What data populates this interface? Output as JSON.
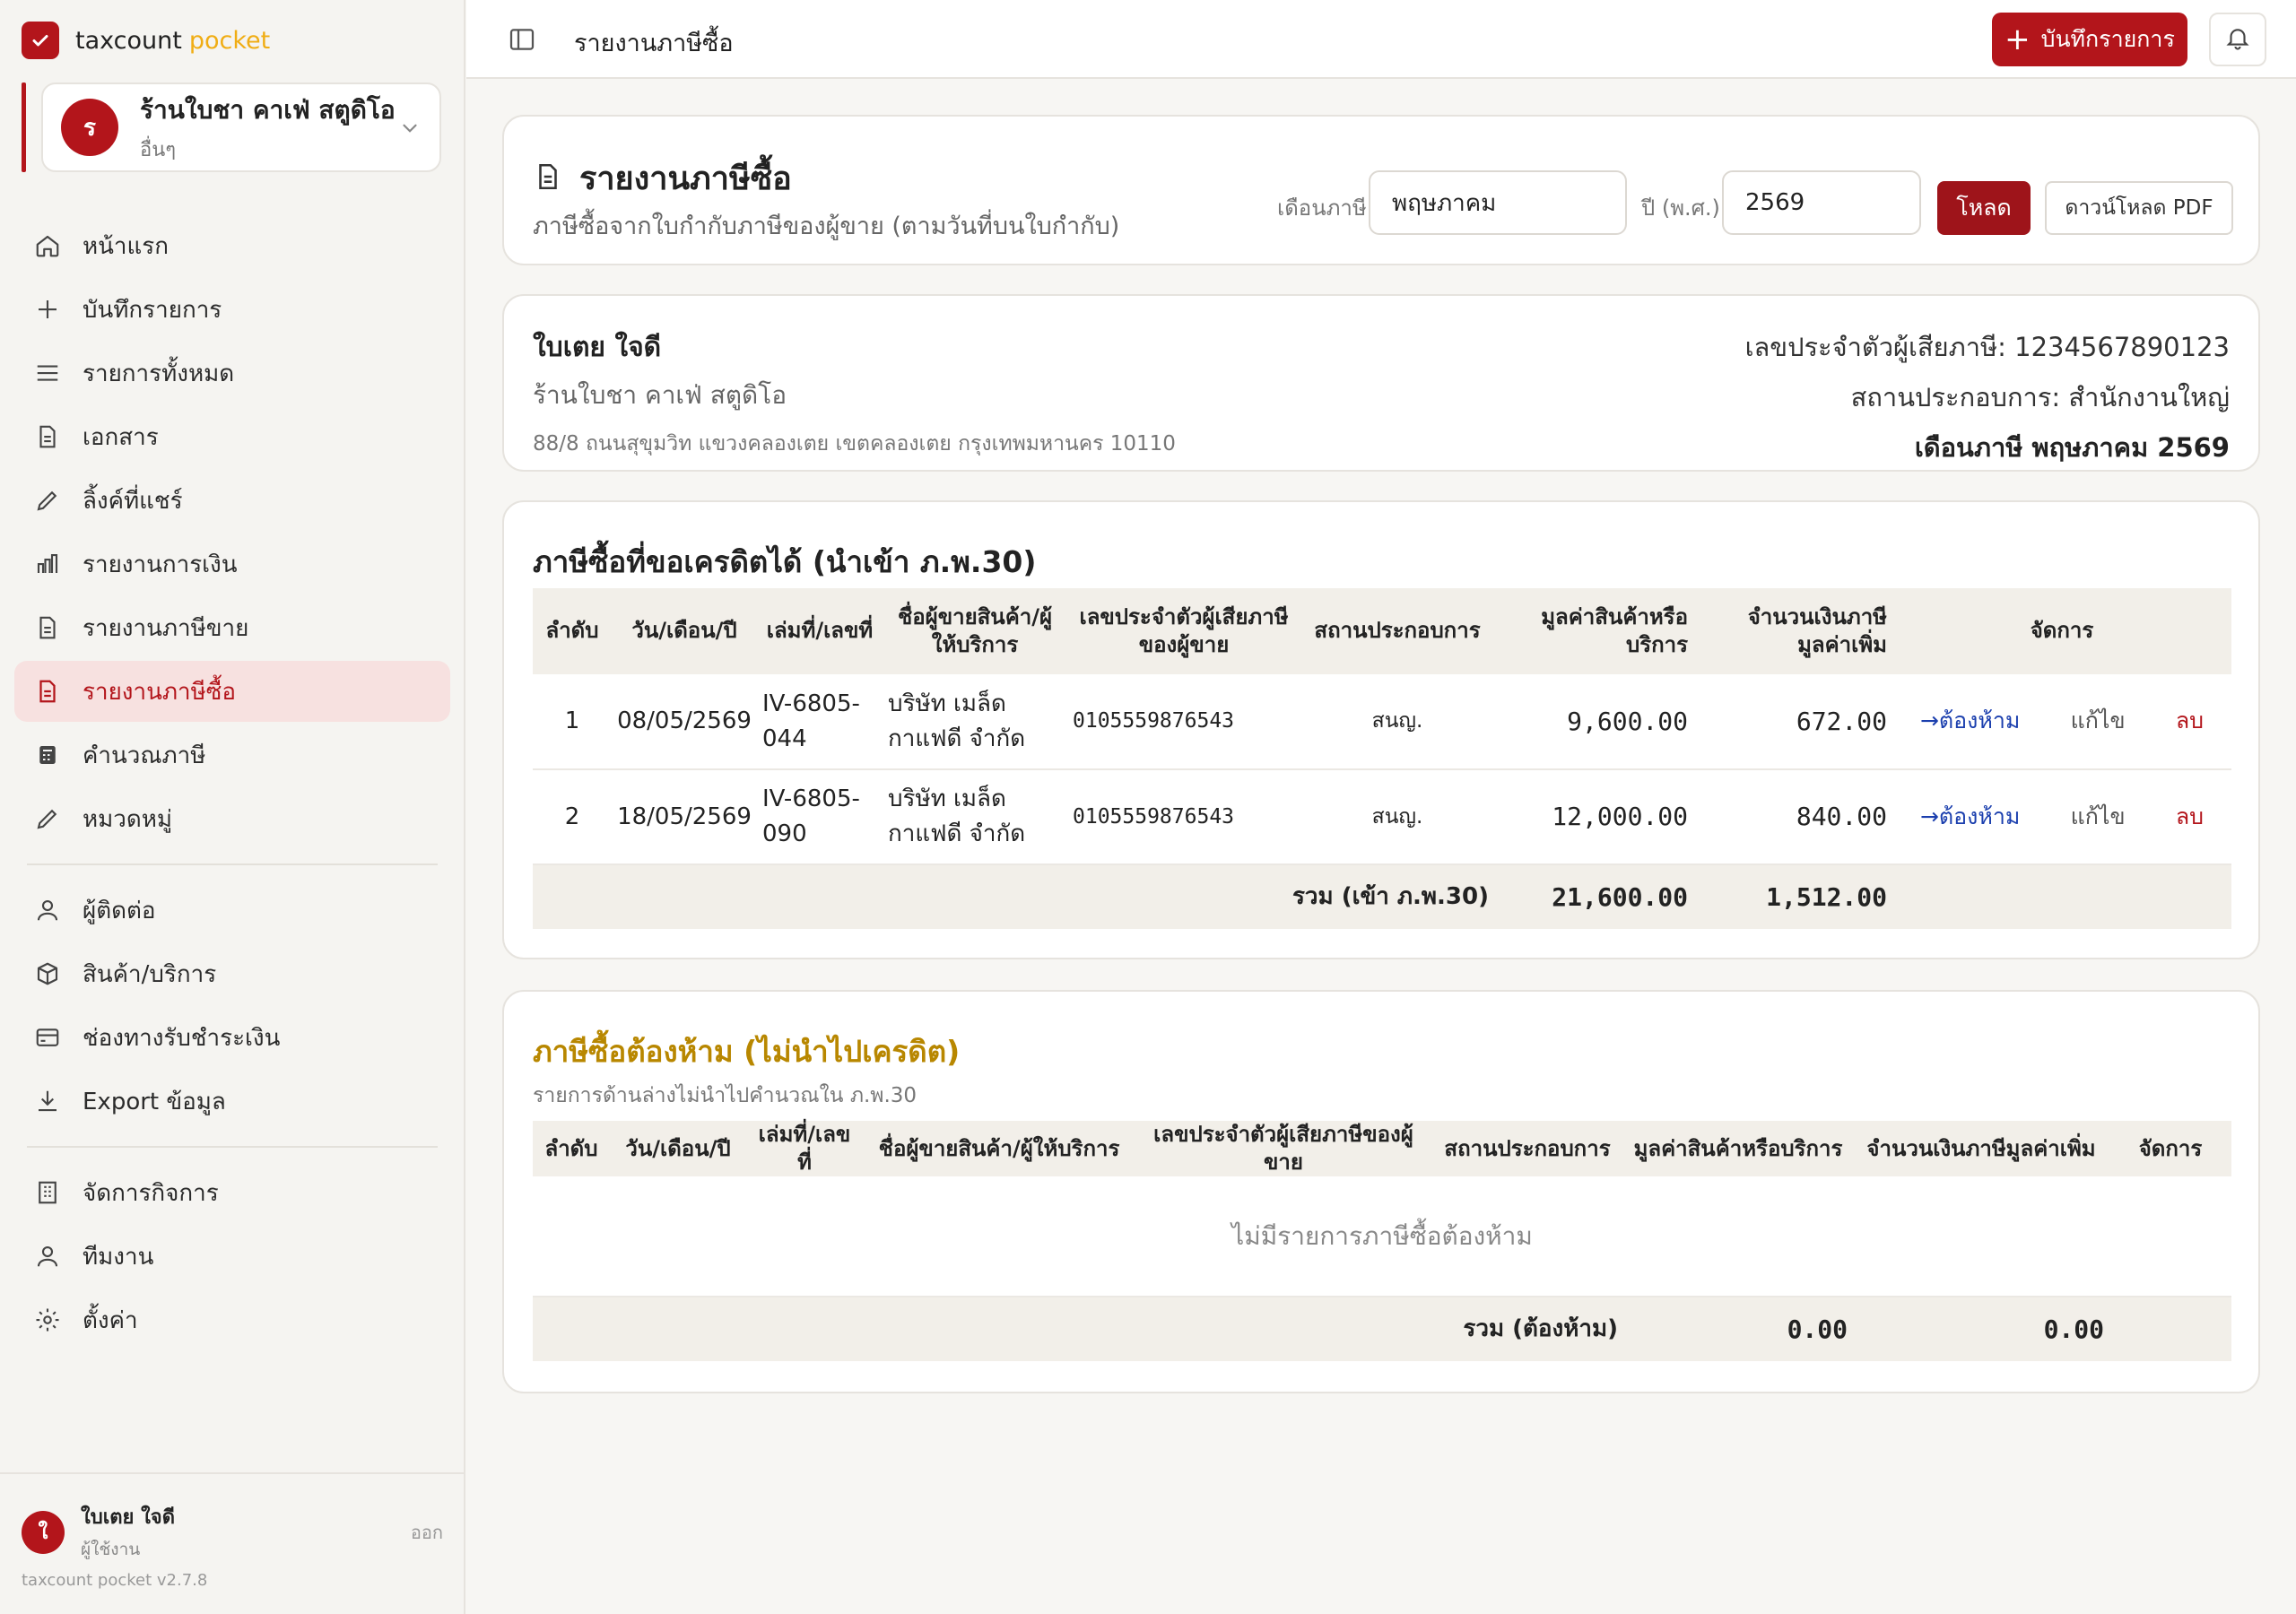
{
  "sidebar": {
    "brand": {
      "name": "taxcount",
      "accent": "pocket"
    },
    "business": {
      "avatar": "ร",
      "name": "ร้านใบชา คาเฟ่ สตูดิโอ",
      "type": "อื่นๆ"
    },
    "nav": [
      {
        "label": "หน้าแรก",
        "icon": "home-icon"
      },
      {
        "label": "บันทึกรายการ",
        "icon": "plus-icon"
      },
      {
        "label": "รายการทั้งหมด",
        "icon": "list-icon"
      },
      {
        "label": "เอกสาร",
        "icon": "document-icon"
      },
      {
        "label": "ลิ้งค์ที่แชร์",
        "icon": "pencil-icon"
      },
      {
        "label": "รายงานการเงิน",
        "icon": "bar-chart-icon"
      },
      {
        "label": "รายงานภาษีขาย",
        "icon": "document-icon"
      },
      {
        "label": "รายงานภาษีซื้อ",
        "icon": "document-icon"
      },
      {
        "label": "คำนวณภาษี",
        "icon": "calculator-icon"
      },
      {
        "label": "หมวดหมู่",
        "icon": "pencil-icon"
      }
    ],
    "nav2": [
      {
        "label": "ผู้ติดต่อ",
        "icon": "user-icon"
      },
      {
        "label": "สินค้า/บริการ",
        "icon": "box-icon"
      },
      {
        "label": "ช่องทางรับชำระเงิน",
        "icon": "credit-card-icon"
      },
      {
        "label": "Export ข้อมูล",
        "icon": "download-icon"
      }
    ],
    "nav3": [
      {
        "label": "จัดการกิจการ",
        "icon": "building-icon"
      },
      {
        "label": "ทีมงาน",
        "icon": "user-icon"
      },
      {
        "label": "ตั้งค่า",
        "icon": "gear-icon"
      }
    ],
    "user": {
      "avatar": "ใ",
      "name": "ใบเตย ใจดี",
      "role": "ผู้ใช้งาน",
      "logout": "ออก"
    },
    "version": "taxcount pocket v2.7.8"
  },
  "topbar": {
    "title": "รายงานภาษีซื้อ",
    "record_label": "บันทึกรายการ"
  },
  "report": {
    "title": "รายงานภาษีซื้อ",
    "subtitle": "ภาษีซื้อจากใบกำกับภาษีของผู้ขาย (ตามวันที่บนใบกำกับ)",
    "month_label": "เดือนภาษี",
    "month_value": "พฤษภาคม",
    "year_label": "ปี (พ.ศ.)",
    "year_value": "2569",
    "load_label": "โหลด",
    "pdf_label": "ดาวน์โหลด PDF"
  },
  "info": {
    "name": "ใบเตย ใจดี",
    "shop": "ร้านใบชา คาเฟ่ สตูดิโอ",
    "address": "88/8 ถนนสุขุมวิท แขวงคลองเตย เขตคลองเตย กรุงเทพมหานคร 10110",
    "tax_id": "เลขประจำตัวผู้เสียภาษี: 1234567890123",
    "branch": "สถานประกอบการ: สำนักงานใหญ่",
    "month": "เดือนภาษี พฤษภาคม 2569"
  },
  "credit": {
    "title": "ภาษีซื้อที่ขอเครดิตได้ (นำเข้า ภ.พ.30)",
    "headers": [
      "ลำดับ",
      "วัน/เดือน/ปี",
      "เล่มที่/เลขที่",
      "ชื่อผู้ขายสินค้า/ผู้ให้บริการ",
      "เลขประจำตัวผู้เสียภาษีของผู้ขาย",
      "สถานประกอบการ",
      "มูลค่าสินค้าหรือบริการ",
      "จำนวนเงินภาษีมูลค่าเพิ่ม",
      "จัดการ"
    ],
    "rows": [
      {
        "no": "1",
        "date": "08/05/2569",
        "doc": "IV-6805-044",
        "vendor": "บริษัท เมล็ดกาแฟดี จำกัด",
        "tax_id": "0105559876543",
        "branch": "สนญ.",
        "amount": "9,600.00",
        "vat": "672.00",
        "action_forbid": "→ต้องห้าม",
        "action_edit": "แก้ไข",
        "action_delete": "ลบ"
      },
      {
        "no": "2",
        "date": "18/05/2569",
        "doc": "IV-6805-090",
        "vendor": "บริษัท เมล็ดกาแฟดี จำกัด",
        "tax_id": "0105559876543",
        "branch": "สนญ.",
        "amount": "12,000.00",
        "vat": "840.00",
        "action_forbid": "→ต้องห้าม",
        "action_edit": "แก้ไข",
        "action_delete": "ลบ"
      }
    ],
    "total_label": "รวม (เข้า ภ.พ.30)",
    "total_amount": "21,600.00",
    "total_vat": "1,512.00"
  },
  "forbidden": {
    "title": "ภาษีซื้อต้องห้าม (ไม่นำไปเครดิต)",
    "note": "รายการด้านล่างไม่นำไปคำนวณใน ภ.พ.30",
    "headers": [
      "ลำดับ",
      "วัน/เดือน/ปี",
      "เล่มที่/เลขที่",
      "ชื่อผู้ขายสินค้า/ผู้ให้บริการ",
      "เลขประจำตัวผู้เสียภาษีของผู้ขาย",
      "สถานประกอบการ",
      "มูลค่าสินค้าหรือบริการ",
      "จำนวนเงินภาษีมูลค่าเพิ่ม",
      "จัดการ"
    ],
    "empty": "ไม่มีรายการภาษีซื้อต้องห้าม",
    "total_label": "รวม (ต้องห้าม)",
    "total_amount": "0.00",
    "total_vat": "0.00"
  },
  "colors": {
    "brand": "#b3151b",
    "accent": "#f0ad14",
    "gold": "#b88700",
    "link": "#1b3fae"
  }
}
